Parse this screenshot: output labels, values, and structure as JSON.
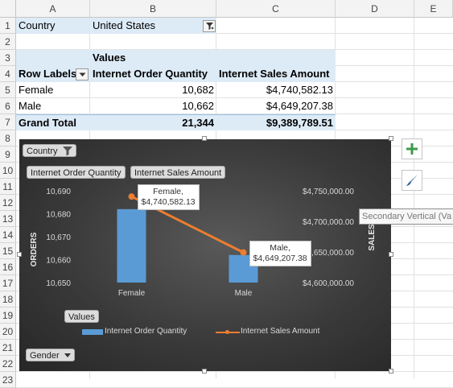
{
  "columns": [
    "A",
    "B",
    "C",
    "D",
    "E"
  ],
  "rows": [
    "1",
    "2",
    "3",
    "4",
    "5",
    "6",
    "7",
    "8",
    "9",
    "10",
    "11",
    "12",
    "13",
    "14",
    "15",
    "16",
    "17",
    "18",
    "19",
    "20",
    "21",
    "22",
    "23"
  ],
  "filter": {
    "label": "Country",
    "value": "United States"
  },
  "pivot": {
    "values_caption": "Values",
    "row_labels": "Row Labels",
    "col1": "Internet Order Quantity",
    "col2": "Internet Sales Amount",
    "rows": [
      {
        "label": "Female",
        "qty": "10,682",
        "amount": "$4,740,582.13"
      },
      {
        "label": "Male",
        "qty": "10,662",
        "amount": "$4,649,207.38"
      }
    ],
    "total": {
      "label": "Grand Total",
      "qty": "21,344",
      "amount": "$9,389,789.51"
    }
  },
  "chart_panel": {
    "country_button": "Country",
    "value_buttons": [
      "Internet Order Quantity",
      "Internet Sales Amount"
    ],
    "values_button": "Values",
    "gender_button": "Gender"
  },
  "tooltip": "Secondary Vertical (Va",
  "colors": {
    "bar": "#5b9bd5",
    "line": "#ed7d31",
    "header_fill": "#ddebf7"
  },
  "icons": {
    "add": "plus-icon",
    "style": "paintbrush-icon",
    "filter": "funnel-icon"
  },
  "chart_data": {
    "type": "bar",
    "categories": [
      "Female",
      "Male"
    ],
    "series": [
      {
        "name": "Internet Order Quantity",
        "type": "bar",
        "axis": "primary",
        "values": [
          10682,
          10662
        ]
      },
      {
        "name": "Internet Sales Amount",
        "type": "line",
        "axis": "secondary",
        "values": [
          4740582.13,
          4649207.38
        ]
      }
    ],
    "ylabel": "ORDERS",
    "y2label": "SALES",
    "ylim": [
      10650,
      10690
    ],
    "y2lim": [
      4600000,
      4750000
    ],
    "yticks": [
      "10,650",
      "10,660",
      "10,670",
      "10,680",
      "10,690"
    ],
    "y2ticks": [
      "$4,600,000.00",
      "$4,650,000.00",
      "$4,700,000.00",
      "$4,750,000.00"
    ],
    "data_labels": [
      {
        "name": "Female,",
        "value": "$4,740,582.13"
      },
      {
        "name": "Male,",
        "value": "$4,649,207.38"
      }
    ],
    "legend": [
      "Internet Order Quantity",
      "Internet Sales Amount"
    ],
    "legend_position": "bottom",
    "grid": false
  }
}
